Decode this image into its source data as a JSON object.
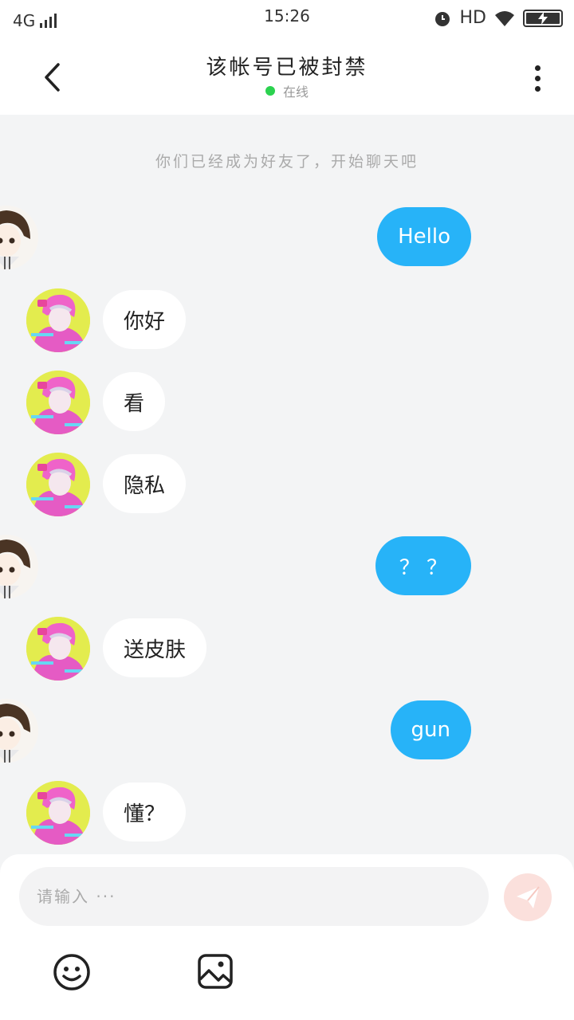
{
  "status_bar": {
    "network": "4G",
    "time": "15:26",
    "hd": "HD"
  },
  "header": {
    "title": "该帐号已被封禁",
    "status": "在线"
  },
  "system_message": "你们已经成为好友了，开始聊天吧",
  "messages": [
    {
      "side": "right",
      "text": "Hello"
    },
    {
      "side": "left",
      "text": "你好"
    },
    {
      "side": "left",
      "text": "看"
    },
    {
      "side": "left",
      "text": "隐私"
    },
    {
      "side": "right",
      "text": "？ ？"
    },
    {
      "side": "left",
      "text": "送皮肤"
    },
    {
      "side": "right",
      "text": "gun"
    },
    {
      "side": "left",
      "text": "懂？"
    }
  ],
  "input": {
    "placeholder": "请输入 ···"
  },
  "colors": {
    "outgoing_bubble": "#27b3f8",
    "incoming_bubble": "#ffffff",
    "online_dot": "#2bd24f",
    "send_button": "#fbe0dc",
    "background": "#f3f4f5"
  },
  "icons": {
    "back": "chevron-left-icon",
    "more": "more-vertical-icon",
    "send": "paper-plane-icon",
    "emoji": "smiley-icon",
    "image": "image-icon"
  }
}
